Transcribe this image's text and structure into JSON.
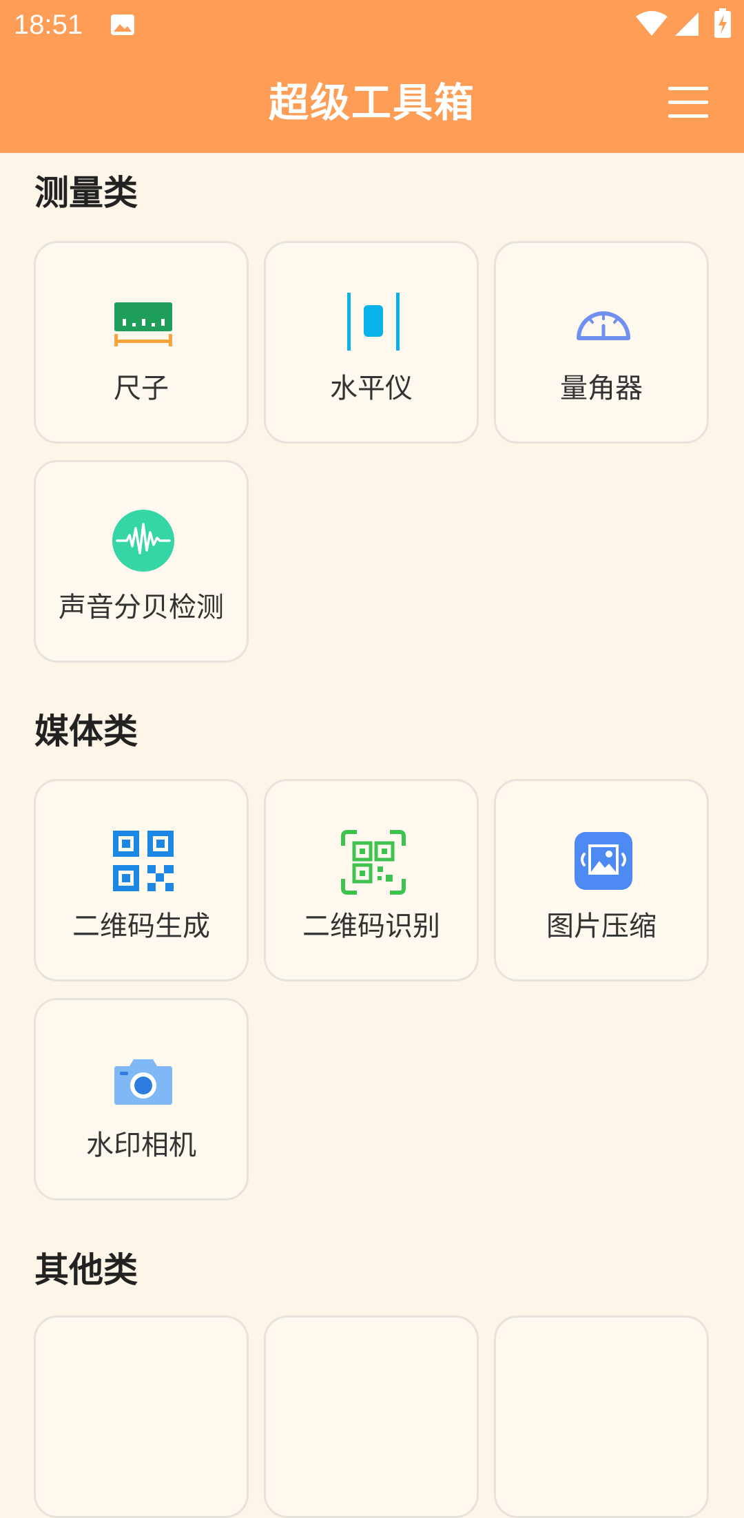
{
  "status_bar": {
    "time": "18:51",
    "icons": [
      "gallery-icon",
      "wifi-icon",
      "signal-icon",
      "battery-charging-icon"
    ]
  },
  "app_bar": {
    "title": "超级工具箱",
    "menu_icon": "hamburger-menu-icon"
  },
  "colors": {
    "header": "#fd9d56",
    "background": "#fdf5e8",
    "card": "#fef8ee",
    "card_border": "#e6e2dc"
  },
  "sections": [
    {
      "title": "测量类",
      "tools": [
        {
          "label": "尺子",
          "icon": "ruler-icon"
        },
        {
          "label": "水平仪",
          "icon": "spirit-level-icon"
        },
        {
          "label": "量角器",
          "icon": "protractor-icon"
        },
        {
          "label": "声音分贝检测",
          "icon": "sound-wave-icon"
        }
      ]
    },
    {
      "title": "媒体类",
      "tools": [
        {
          "label": "二维码生成",
          "icon": "qr-code-icon"
        },
        {
          "label": "二维码识别",
          "icon": "qr-scan-icon"
        },
        {
          "label": "图片压缩",
          "icon": "image-compress-icon"
        },
        {
          "label": "水印相机",
          "icon": "camera-icon"
        }
      ]
    },
    {
      "title": "其他类",
      "tools": []
    }
  ]
}
